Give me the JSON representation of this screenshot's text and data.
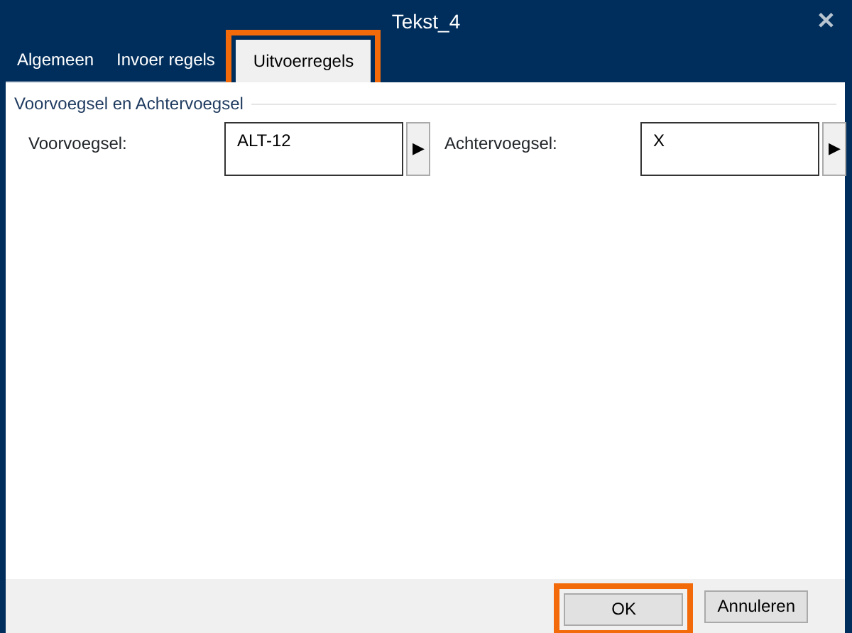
{
  "window": {
    "title": "Tekst_4",
    "close": "✕"
  },
  "tabs": [
    {
      "label": "Algemeen",
      "selected": false,
      "highlighted": false
    },
    {
      "label": "Invoer regels",
      "selected": false,
      "highlighted": false
    },
    {
      "label": "Uitvoerregels",
      "selected": true,
      "highlighted": true
    }
  ],
  "group": {
    "title": "Voorvoegsel en Achtervoegsel",
    "fields": [
      {
        "label": "Voorvoegsel:",
        "value": "ALT-12",
        "button": "▶"
      },
      {
        "label": "Achtervoegsel:",
        "value": "X",
        "button": "▶"
      }
    ]
  },
  "buttons": [
    {
      "label": "OK",
      "highlighted": true
    },
    {
      "label": "Annuleren",
      "highlighted": false
    }
  ]
}
